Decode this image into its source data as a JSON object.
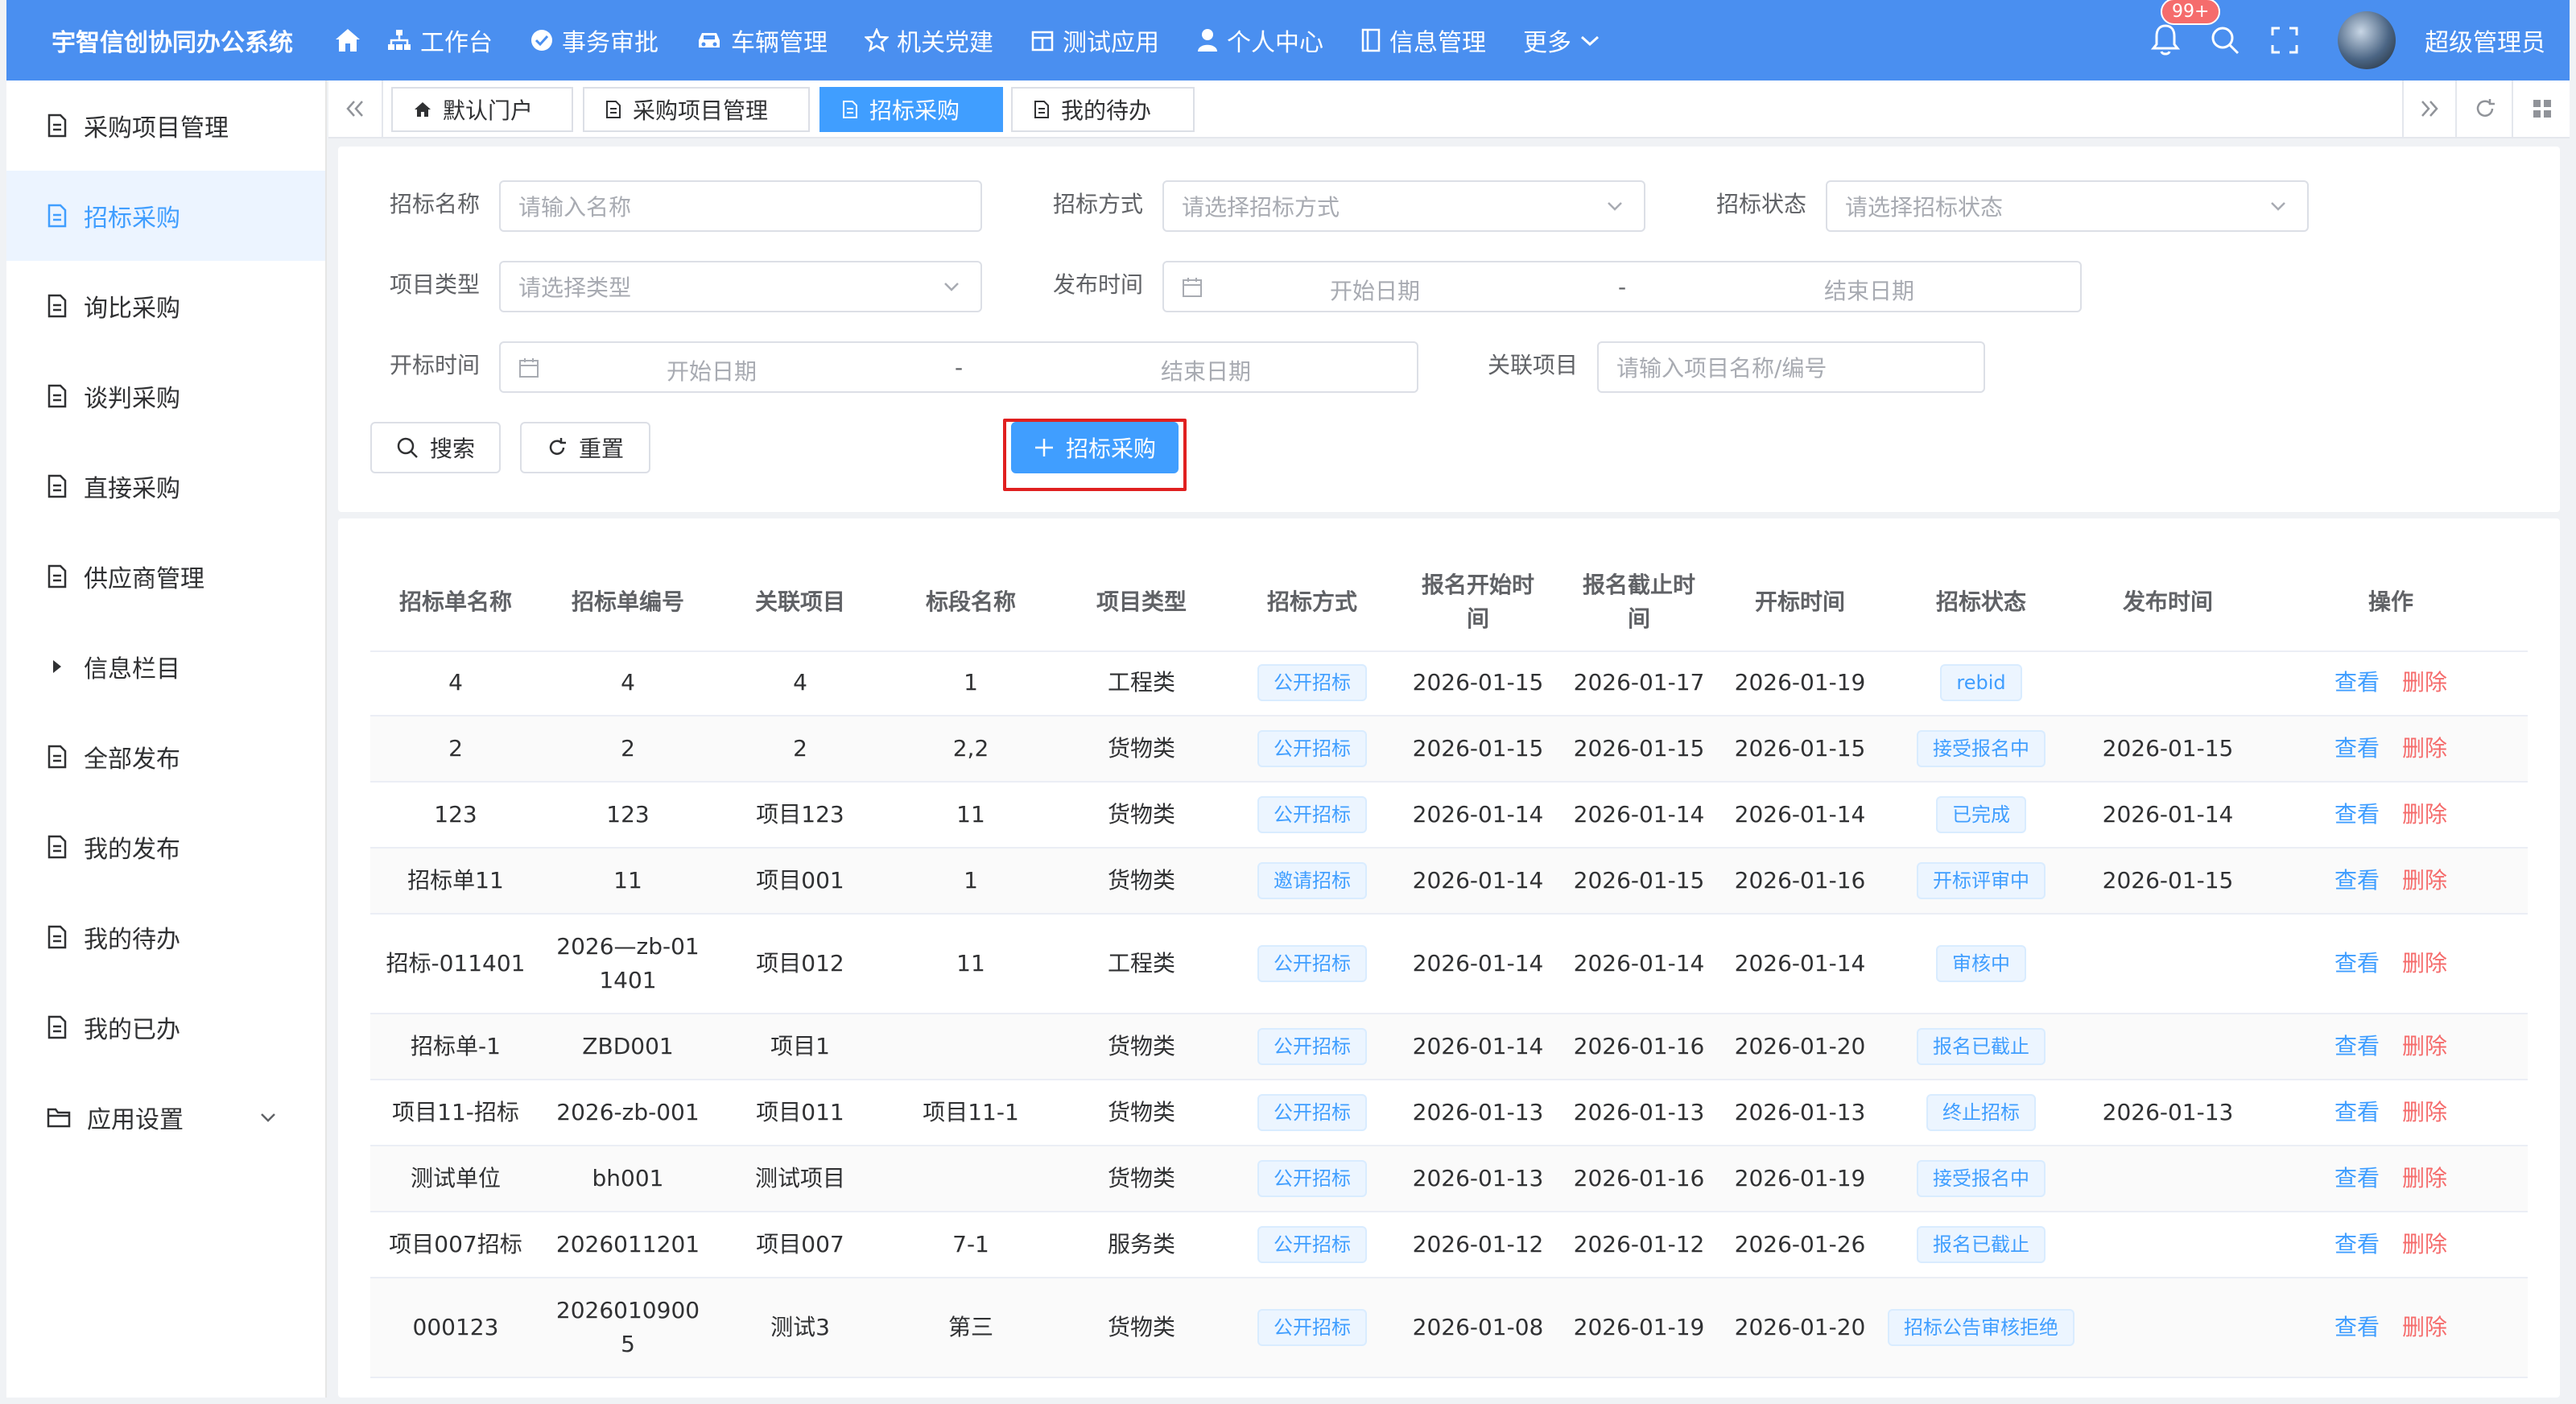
{
  "app": {
    "title": "宇智信创协同办公系统"
  },
  "nav": [
    {
      "label": "工作台",
      "icon": "workbench-icon"
    },
    {
      "label": "事务审批",
      "icon": "approval-icon"
    },
    {
      "label": "车辆管理",
      "icon": "car-icon"
    },
    {
      "label": "机关党建",
      "icon": "star-icon"
    },
    {
      "label": "测试应用",
      "icon": "app-icon"
    },
    {
      "label": "个人中心",
      "icon": "user-icon"
    },
    {
      "label": "信息管理",
      "icon": "info-icon"
    },
    {
      "label": "更多",
      "icon": "chevron-down-icon"
    }
  ],
  "header": {
    "badge": "99+",
    "username": "超级管理员"
  },
  "sidebar": {
    "items": [
      {
        "label": "采购项目管理"
      },
      {
        "label": "招标采购"
      },
      {
        "label": "询比采购"
      },
      {
        "label": "谈判采购"
      },
      {
        "label": "直接采购"
      },
      {
        "label": "供应商管理"
      },
      {
        "label": "信息栏目"
      },
      {
        "label": "全部发布"
      },
      {
        "label": "我的发布"
      },
      {
        "label": "我的待办"
      },
      {
        "label": "我的已办"
      },
      {
        "label": "应用设置"
      }
    ]
  },
  "tabs": [
    {
      "label": "默认门户"
    },
    {
      "label": "采购项目管理"
    },
    {
      "label": "招标采购"
    },
    {
      "label": "我的待办"
    }
  ],
  "filters": {
    "name_label": "招标名称",
    "name_placeholder": "请输入名称",
    "method_label": "招标方式",
    "method_placeholder": "请选择招标方式",
    "status_label": "招标状态",
    "status_placeholder": "请选择招标状态",
    "type_label": "项目类型",
    "type_placeholder": "请选择类型",
    "publish_label": "发布时间",
    "open_label": "开标时间",
    "start_placeholder": "开始日期",
    "end_placeholder": "结束日期",
    "range_sep": "-",
    "project_label": "关联项目",
    "project_placeholder": "请输入项目名称/编号"
  },
  "buttons": {
    "search": "搜索",
    "reset": "重置",
    "add": "招标采购"
  },
  "table": {
    "columns": [
      "招标单名称",
      "招标单编号",
      "关联项目",
      "标段名称",
      "项目类型",
      "招标方式",
      "报名开始时间",
      "报名截止时间",
      "开标时间",
      "招标状态",
      "发布时间",
      "操作"
    ],
    "view_label": "查看",
    "delete_label": "删除",
    "rows": [
      {
        "name": "4",
        "code": "4",
        "project": "4",
        "section": "1",
        "type": "工程类",
        "method": "公开招标",
        "reg_start": "2026-01-15",
        "reg_end": "2026-01-17",
        "open": "2026-01-19",
        "status": "rebid",
        "publish": ""
      },
      {
        "name": "2",
        "code": "2",
        "project": "2",
        "section": "2,2",
        "type": "货物类",
        "method": "公开招标",
        "reg_start": "2026-01-15",
        "reg_end": "2026-01-15",
        "open": "2026-01-15",
        "status": "接受报名中",
        "publish": "2026-01-15"
      },
      {
        "name": "123",
        "code": "123",
        "project": "项目123",
        "section": "11",
        "type": "货物类",
        "method": "公开招标",
        "reg_start": "2026-01-14",
        "reg_end": "2026-01-14",
        "open": "2026-01-14",
        "status": "已完成",
        "publish": "2026-01-14"
      },
      {
        "name": "招标单11",
        "code": "11",
        "project": "项目001",
        "section": "1",
        "type": "货物类",
        "method": "邀请招标",
        "reg_start": "2026-01-14",
        "reg_end": "2026-01-15",
        "open": "2026-01-16",
        "status": "开标评审中",
        "publish": "2026-01-15"
      },
      {
        "name": "招标-011401",
        "code": "2026—zb-01 1401",
        "project": "项目012",
        "section": "11",
        "type": "工程类",
        "method": "公开招标",
        "reg_start": "2026-01-14",
        "reg_end": "2026-01-14",
        "open": "2026-01-14",
        "status": "审核中",
        "publish": ""
      },
      {
        "name": "招标单-1",
        "code": "ZBD001",
        "project": "项目1",
        "section": "",
        "type": "货物类",
        "method": "公开招标",
        "reg_start": "2026-01-14",
        "reg_end": "2026-01-16",
        "open": "2026-01-20",
        "status": "报名已截止",
        "publish": ""
      },
      {
        "name": "项目11-招标",
        "code": "2026-zb-001",
        "project": "项目011",
        "section": "项目11-1",
        "type": "货物类",
        "method": "公开招标",
        "reg_start": "2026-01-13",
        "reg_end": "2026-01-13",
        "open": "2026-01-13",
        "status": "终止招标",
        "publish": "2026-01-13"
      },
      {
        "name": "测试单位",
        "code": "bh001",
        "project": "测试项目",
        "section": "",
        "type": "货物类",
        "method": "公开招标",
        "reg_start": "2026-01-13",
        "reg_end": "2026-01-16",
        "open": "2026-01-19",
        "status": "接受报名中",
        "publish": ""
      },
      {
        "name": "项目007招标",
        "code": "2026011201",
        "project": "项目007",
        "section": "7-1",
        "type": "服务类",
        "method": "公开招标",
        "reg_start": "2026-01-12",
        "reg_end": "2026-01-12",
        "open": "2026-01-26",
        "status": "报名已截止",
        "publish": ""
      },
      {
        "name": "000123",
        "code": "2026010900 5",
        "project": "测试3",
        "section": "第三",
        "type": "货物类",
        "method": "公开招标",
        "reg_start": "2026-01-08",
        "reg_end": "2026-01-19",
        "open": "2026-01-20",
        "status": "招标公告审核拒绝",
        "publish": ""
      }
    ]
  }
}
